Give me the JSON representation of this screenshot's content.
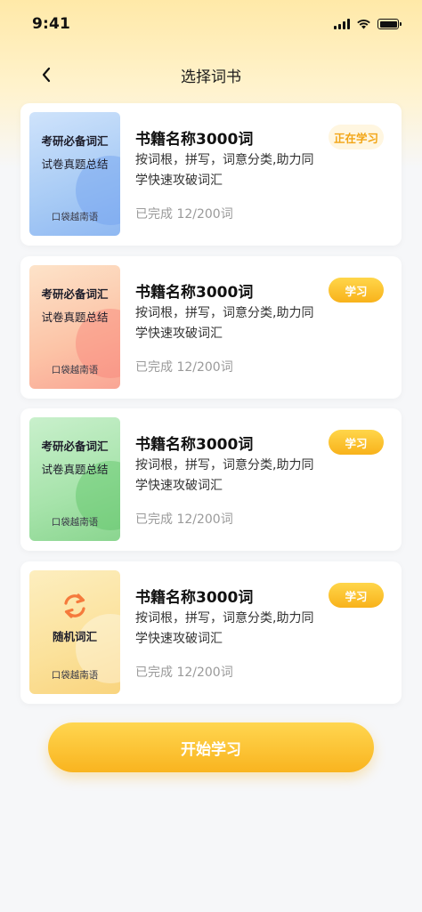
{
  "status_bar": {
    "time": "9:41"
  },
  "nav": {
    "title": "选择词书",
    "back_icon": "chevron-left-icon"
  },
  "colors": {
    "accent": "#f8b21b",
    "accent_light": "#fff6e0",
    "background": "#f6f7f9"
  },
  "books": [
    {
      "cover_title": "考研必备词汇",
      "cover_subtitle": "试卷真题总结",
      "cover_publisher": "口袋越南语",
      "title": "书籍名称3000词",
      "description": "按词根，拼写，词意分类,助力同学快速攻破词汇",
      "progress": "已完成 12/200词",
      "button": "正在学习"
    },
    {
      "cover_title": "考研必备词汇",
      "cover_subtitle": "试卷真题总结",
      "cover_publisher": "口袋越南语",
      "title": "书籍名称3000词",
      "description": "按词根，拼写，词意分类,助力同学快速攻破词汇",
      "progress": "已完成 12/200词",
      "button": "学习"
    },
    {
      "cover_title": "考研必备词汇",
      "cover_subtitle": "试卷真题总结",
      "cover_publisher": "口袋越南语",
      "title": "书籍名称3000词",
      "description": "按词根，拼写，词意分类,助力同学快速攻破词汇",
      "progress": "已完成 12/200词",
      "button": "学习"
    },
    {
      "cover_title": "随机词汇",
      "cover_icon": "refresh-icon",
      "cover_publisher": "口袋越南语",
      "title": "书籍名称3000词",
      "description": "按词根，拼写，词意分类,助力同学快速攻破词汇",
      "progress": "已完成 12/200词",
      "button": "学习"
    }
  ],
  "start_button": "开始学习"
}
